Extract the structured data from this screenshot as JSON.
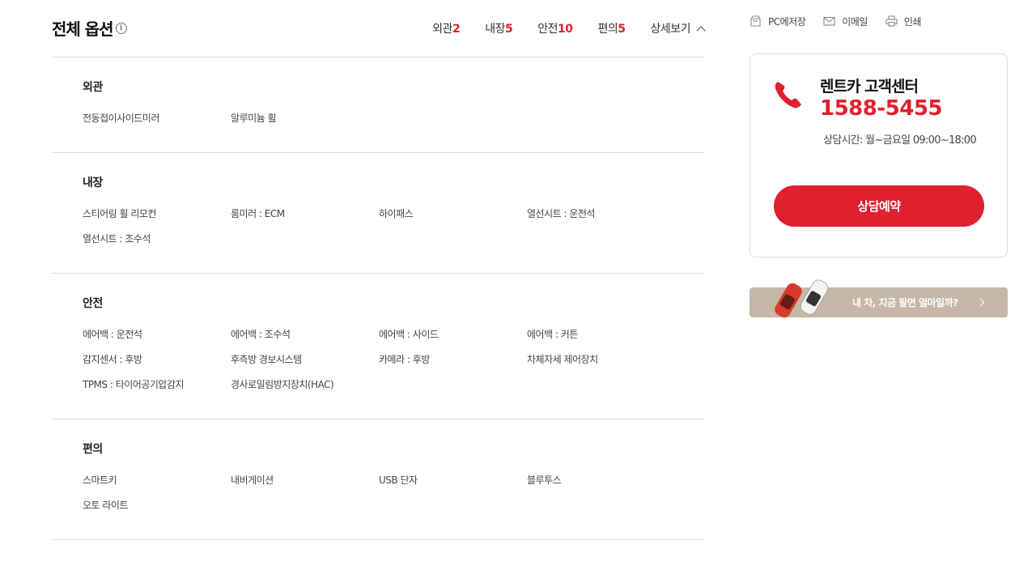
{
  "header": {
    "title": "전체 옵션",
    "info_icon": "info-icon",
    "nav": [
      {
        "label": "외관",
        "count": "2"
      },
      {
        "label": "내장",
        "count": "5"
      },
      {
        "label": "안전",
        "count": "10"
      },
      {
        "label": "편의",
        "count": "5"
      }
    ],
    "more_label": "상세보기"
  },
  "sections": [
    {
      "title": "외관",
      "items": [
        "전동접이사이드미러",
        "알루미늄 휠"
      ]
    },
    {
      "title": "내장",
      "items": [
        "스티어링 휠 리모컨",
        "룸미러 : ECM",
        "하이패스",
        "열선시트 : 운전석",
        "열선시트 : 조수석"
      ]
    },
    {
      "title": "안전",
      "items": [
        "에어백 : 운전석",
        "에어백 : 조수석",
        "에어백 : 사이드",
        "에어백 : 커튼",
        "감지센서 : 후방",
        "후측방 경보시스템",
        "카메라 : 후방",
        "차체자세 제어장치",
        "TPMS : 타이어공기압감지",
        "경사로밀림방지장치(HAC)"
      ]
    },
    {
      "title": "편의",
      "items": [
        "스마트키",
        "내비게이션",
        "USB 단자",
        "블루투스",
        "오토 라이트"
      ]
    }
  ],
  "tools": {
    "save": "PC에저장",
    "email": "이메일",
    "print": "인쇄"
  },
  "cs": {
    "title": "렌트카 고객센터",
    "phone": "1588-5455",
    "hours": "상담시간: 월~금요일 09:00~18:00",
    "button": "상담예약"
  },
  "banner": {
    "text": "내 차, 지금 팔면 얼마일까?"
  },
  "colors": {
    "accent": "#e0202f",
    "banner_bg": "#c6b7a6"
  }
}
